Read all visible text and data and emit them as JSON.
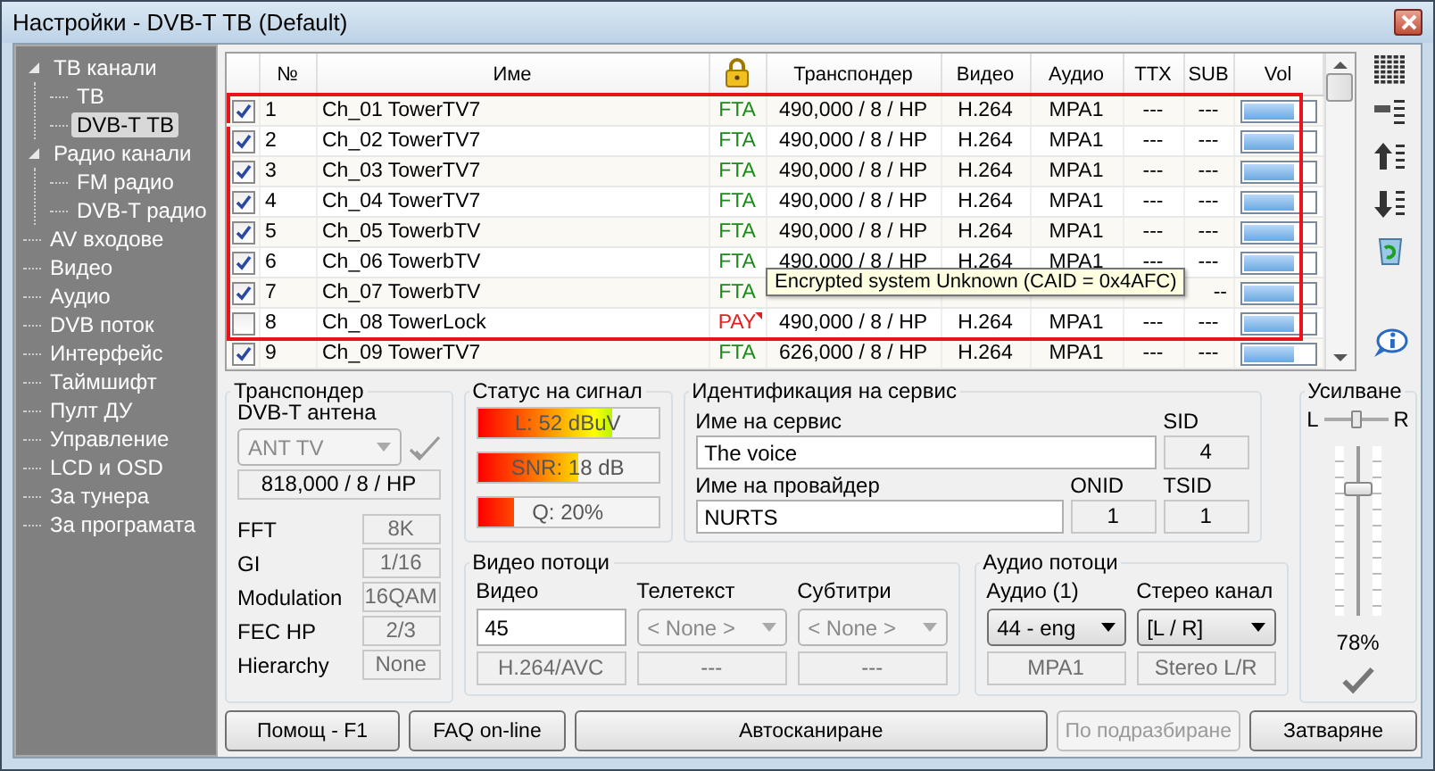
{
  "window": {
    "title": "Настройки - DVB-T ТВ (Default)"
  },
  "sidebar": {
    "items": [
      {
        "label": "ТВ канали",
        "selected": false,
        "expanded": true,
        "children": [
          {
            "label": "ТВ",
            "selected": false
          },
          {
            "label": "DVB-T ТВ",
            "selected": true
          }
        ]
      },
      {
        "label": "Радио канали",
        "selected": false,
        "expanded": true,
        "children": [
          {
            "label": "FM радио",
            "selected": false
          },
          {
            "label": "DVB-T радио",
            "selected": false
          }
        ]
      },
      {
        "label": "AV входове",
        "selected": false
      },
      {
        "label": "Видео",
        "selected": false
      },
      {
        "label": "Аудио",
        "selected": false
      },
      {
        "label": "DVB поток",
        "selected": false
      },
      {
        "label": "Интерфейс",
        "selected": false
      },
      {
        "label": "Таймшифт",
        "selected": false
      },
      {
        "label": "Пулт ДУ",
        "selected": false
      },
      {
        "label": "Управление",
        "selected": false
      },
      {
        "label": "LCD и OSD",
        "selected": false
      },
      {
        "label": "За тунера",
        "selected": false
      },
      {
        "label": "За програмата",
        "selected": false
      }
    ]
  },
  "table": {
    "columns": [
      "№",
      "Име",
      "Транспондер",
      "Видео",
      "Аудио",
      "TTX",
      "SUB",
      "Vol"
    ],
    "rows": [
      {
        "checked": true,
        "highlighted": true,
        "number": "1",
        "name": "Ch_01 TowerTV7",
        "access": "FTA",
        "encrypted": false,
        "transponder": "490,000 / 8 / HP",
        "video": "H.264",
        "audio": "MPA1",
        "ttx": "---",
        "sub": "---",
        "level": 0.72
      },
      {
        "checked": true,
        "highlighted": true,
        "number": "2",
        "name": "Ch_02 TowerTV7",
        "access": "FTA",
        "encrypted": false,
        "transponder": "490,000 / 8 / HP",
        "video": "H.264",
        "audio": "MPA1",
        "ttx": "---",
        "sub": "---",
        "level": 0.72
      },
      {
        "checked": true,
        "highlighted": true,
        "number": "3",
        "name": "Ch_03 TowerTV7",
        "access": "FTA",
        "encrypted": false,
        "transponder": "490,000 / 8 / HP",
        "video": "H.264",
        "audio": "MPA1",
        "ttx": "---",
        "sub": "---",
        "level": 0.72
      },
      {
        "checked": true,
        "highlighted": true,
        "number": "4",
        "name": "Ch_04 TowerTV7",
        "access": "FTA",
        "encrypted": false,
        "transponder": "490,000 / 8 / HP",
        "video": "H.264",
        "audio": "MPA1",
        "ttx": "---",
        "sub": "---",
        "level": 0.72
      },
      {
        "checked": true,
        "highlighted": true,
        "number": "5",
        "name": "Ch_05 TowerbTV",
        "access": "FTA",
        "encrypted": false,
        "transponder": "490,000 / 8 / HP",
        "video": "H.264",
        "audio": "MPA1",
        "ttx": "---",
        "sub": "---",
        "level": 0.72
      },
      {
        "checked": true,
        "highlighted": true,
        "number": "6",
        "name": "Ch_06 TowerbTV",
        "access": "FTA",
        "encrypted": false,
        "transponder": "490,000 / 8 / HP",
        "video": "H.264",
        "audio": "MPA1",
        "ttx": "---",
        "sub": "---",
        "level": 0.72
      },
      {
        "checked": true,
        "highlighted": true,
        "number": "7",
        "name": "Ch_07 TowerbTV",
        "access": "FTA",
        "encrypted": false,
        "sub": "--",
        "level": 0.72
      },
      {
        "checked": false,
        "highlighted": true,
        "number": "8",
        "name": "Ch_08 TowerLock",
        "access": "PAY",
        "encrypted": true,
        "transponder": "490,000 / 8 / HP",
        "video": "H.264",
        "audio": "MPA1",
        "ttx": "---",
        "sub": "---",
        "level": 0.72
      },
      {
        "checked": true,
        "highlighted": false,
        "number": "9",
        "name": "Ch_09 TowerTV7",
        "access": "FTA",
        "encrypted": false,
        "transponder": "626,000 / 8 / HP",
        "video": "H.264",
        "audio": "MPA1",
        "ttx": "---",
        "sub": "---",
        "level": 0.72
      }
    ],
    "tooltip": "Encrypted system Unknown (CAID = 0x4AFC)"
  },
  "transponder": {
    "title": "Транспондер",
    "antenna_label": "DVB-T антена",
    "antenna": {
      "value": "ANT TV",
      "disabled": true
    },
    "frequency": "818,000 / 8 / HP",
    "params": [
      {
        "label": "FFT",
        "value": "8K"
      },
      {
        "label": "GI",
        "value": "1/16"
      },
      {
        "label": "Modulation",
        "value": "16QAM"
      },
      {
        "label": "FEC HP",
        "value": "2/3"
      },
      {
        "label": "Hierarchy",
        "value": "None"
      }
    ]
  },
  "signal": {
    "title": "Статус на сигнал",
    "meters": [
      {
        "text": "L: 52 dBuV",
        "level": 0.75
      },
      {
        "text": "SNR: 18 dB",
        "level": 0.56
      },
      {
        "text": "Q: 20%",
        "level": 0.2
      }
    ]
  },
  "service": {
    "title": "Идентификация на сервис",
    "name_label": "Име на сервис",
    "name": "The voice",
    "sid_label": "SID",
    "sid": "4",
    "provider_label": "Име на провайдер",
    "provider": "NURTS",
    "onid_label": "ONID",
    "onid": "1",
    "tsid_label": "TSID",
    "tsid": "1"
  },
  "video_streams": {
    "title": "Видео потоци",
    "fields": [
      {
        "label": "Видео",
        "kind": "input",
        "value": "45",
        "info": "H.264/AVC"
      },
      {
        "label": "Телетекст",
        "kind": "combo",
        "value": "< None >",
        "disabled": true,
        "info": "---"
      },
      {
        "label": "Субтитри",
        "kind": "combo",
        "value": "< None >",
        "disabled": true,
        "info": "---"
      }
    ]
  },
  "audio_streams": {
    "title": "Аудио потоци",
    "fields": [
      {
        "label": "Аудио (1)",
        "kind": "combo",
        "value": "44 - eng",
        "disabled": false,
        "info": "MPA1"
      },
      {
        "label": "Стерео канал",
        "kind": "combo",
        "value": "[L / R]",
        "disabled": false,
        "info": "Stereo L/R"
      }
    ]
  },
  "gain": {
    "title": "Усилване",
    "left_label": "L",
    "right_label": "R",
    "balance": {
      "level": 0.5
    },
    "volume": {
      "level": 0.78
    },
    "reading": "78%"
  },
  "buttons": [
    {
      "label": "Помощ - F1",
      "disabled": false
    },
    {
      "label": "FAQ on-line",
      "disabled": false
    },
    {
      "label": "Автосканиране",
      "disabled": false
    },
    {
      "label": "По подразбиране",
      "disabled": true
    },
    {
      "label": "Затваряне",
      "disabled": false
    }
  ]
}
